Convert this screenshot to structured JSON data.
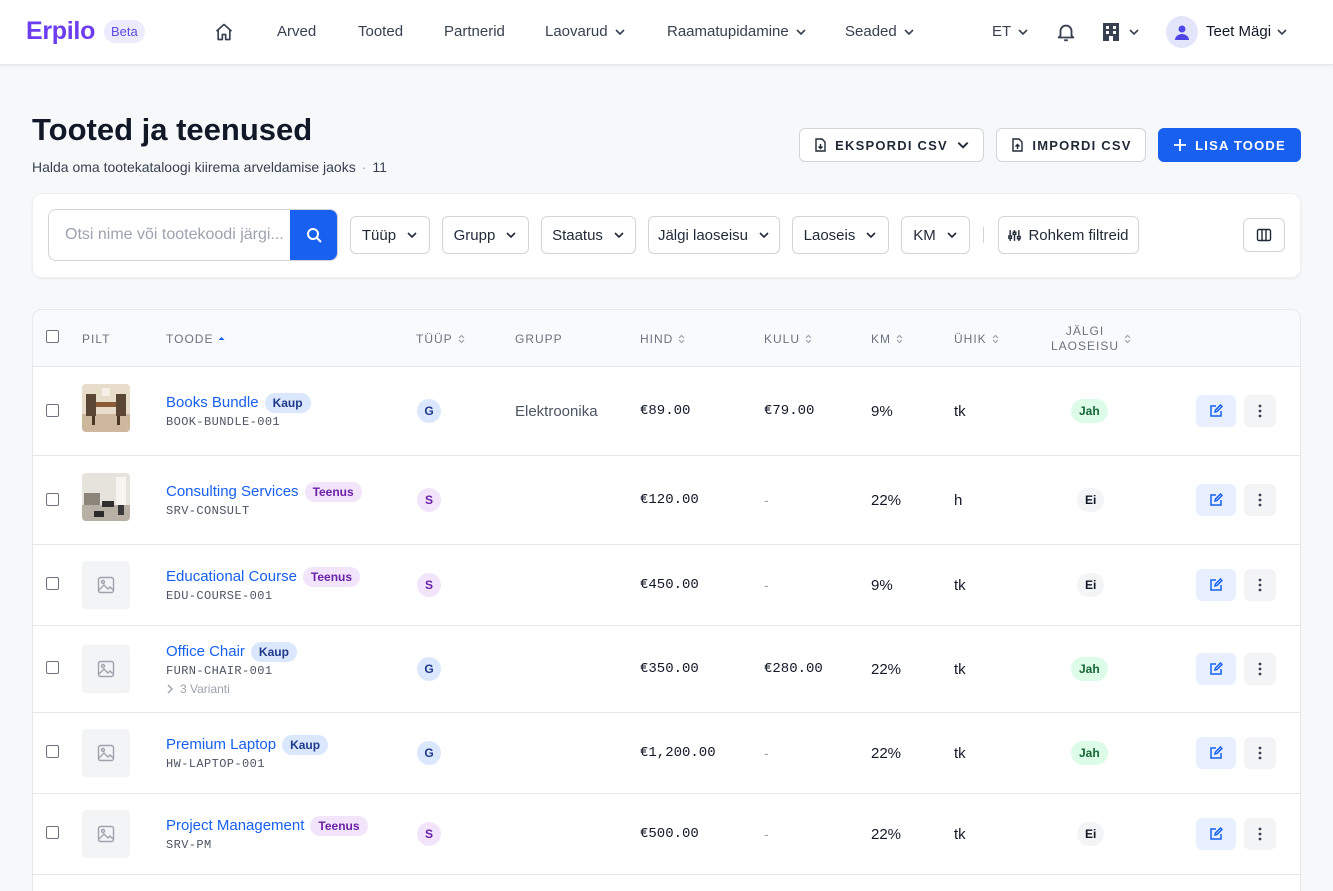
{
  "app": {
    "brand": "Erpilo",
    "badge": "Beta"
  },
  "nav": {
    "items": [
      "Arved",
      "Tooted",
      "Partnerid",
      "Laovarud",
      "Raamatupidamine",
      "Seaded"
    ],
    "language": "ET",
    "user_name": "Teet Mägi"
  },
  "header": {
    "title": "Tooted ja teenused",
    "subtitle": "Halda oma tootekataloogi kiirema arveldamise jaoks",
    "count": "11",
    "export_label": "EKSPORDI CSV",
    "import_label": "IMPORDI CSV",
    "add_label": "LISA TOODE"
  },
  "filters": {
    "search_placeholder": "Otsi nime või tootekoodi järgi...",
    "buttons": [
      "Tüüp",
      "Grupp",
      "Staatus",
      "Jälgi laoseisu",
      "Laoseis",
      "KM"
    ],
    "more_label": "Rohkem filtreid"
  },
  "table": {
    "columns": {
      "image": "PILT",
      "product": "TOODE",
      "type": "TÜÜP",
      "group": "GRUPP",
      "price": "HIND",
      "cost": "KULU",
      "vat": "KM",
      "unit": "ÜHIK",
      "track_line1": "JÄLGI",
      "track_line2": "LAOSEISU"
    },
    "rows": [
      {
        "name": "Books Bundle",
        "badge": "Kaup",
        "sku": "BOOK-BUNDLE-001",
        "type": "G",
        "group": "Elektroonika",
        "price": "€89.00",
        "cost": "€79.00",
        "vat": "9%",
        "unit": "tk",
        "track": "Jah",
        "variants": ""
      },
      {
        "name": "Consulting Services",
        "badge": "Teenus",
        "sku": "SRV-CONSULT",
        "type": "S",
        "group": "",
        "price": "€120.00",
        "cost": "-",
        "vat": "22%",
        "unit": "h",
        "track": "Ei",
        "variants": ""
      },
      {
        "name": "Educational Course",
        "badge": "Teenus",
        "sku": "EDU-COURSE-001",
        "type": "S",
        "group": "",
        "price": "€450.00",
        "cost": "-",
        "vat": "9%",
        "unit": "tk",
        "track": "Ei",
        "variants": ""
      },
      {
        "name": "Office Chair",
        "badge": "Kaup",
        "sku": "FURN-CHAIR-001",
        "type": "G",
        "group": "",
        "price": "€350.00",
        "cost": "€280.00",
        "vat": "22%",
        "unit": "tk",
        "track": "Jah",
        "variants": "3 Varianti"
      },
      {
        "name": "Premium Laptop",
        "badge": "Kaup",
        "sku": "HW-LAPTOP-001",
        "type": "G",
        "group": "",
        "price": "€1,200.00",
        "cost": "-",
        "vat": "22%",
        "unit": "tk",
        "track": "Jah",
        "variants": ""
      },
      {
        "name": "Project Management",
        "badge": "Teenus",
        "sku": "SRV-PM",
        "type": "S",
        "group": "",
        "price": "€500.00",
        "cost": "-",
        "vat": "22%",
        "unit": "tk",
        "track": "Ei",
        "variants": ""
      }
    ]
  },
  "colors": {
    "brand": "#6d3df0",
    "primary": "#1760f0",
    "link": "#1760f0"
  }
}
